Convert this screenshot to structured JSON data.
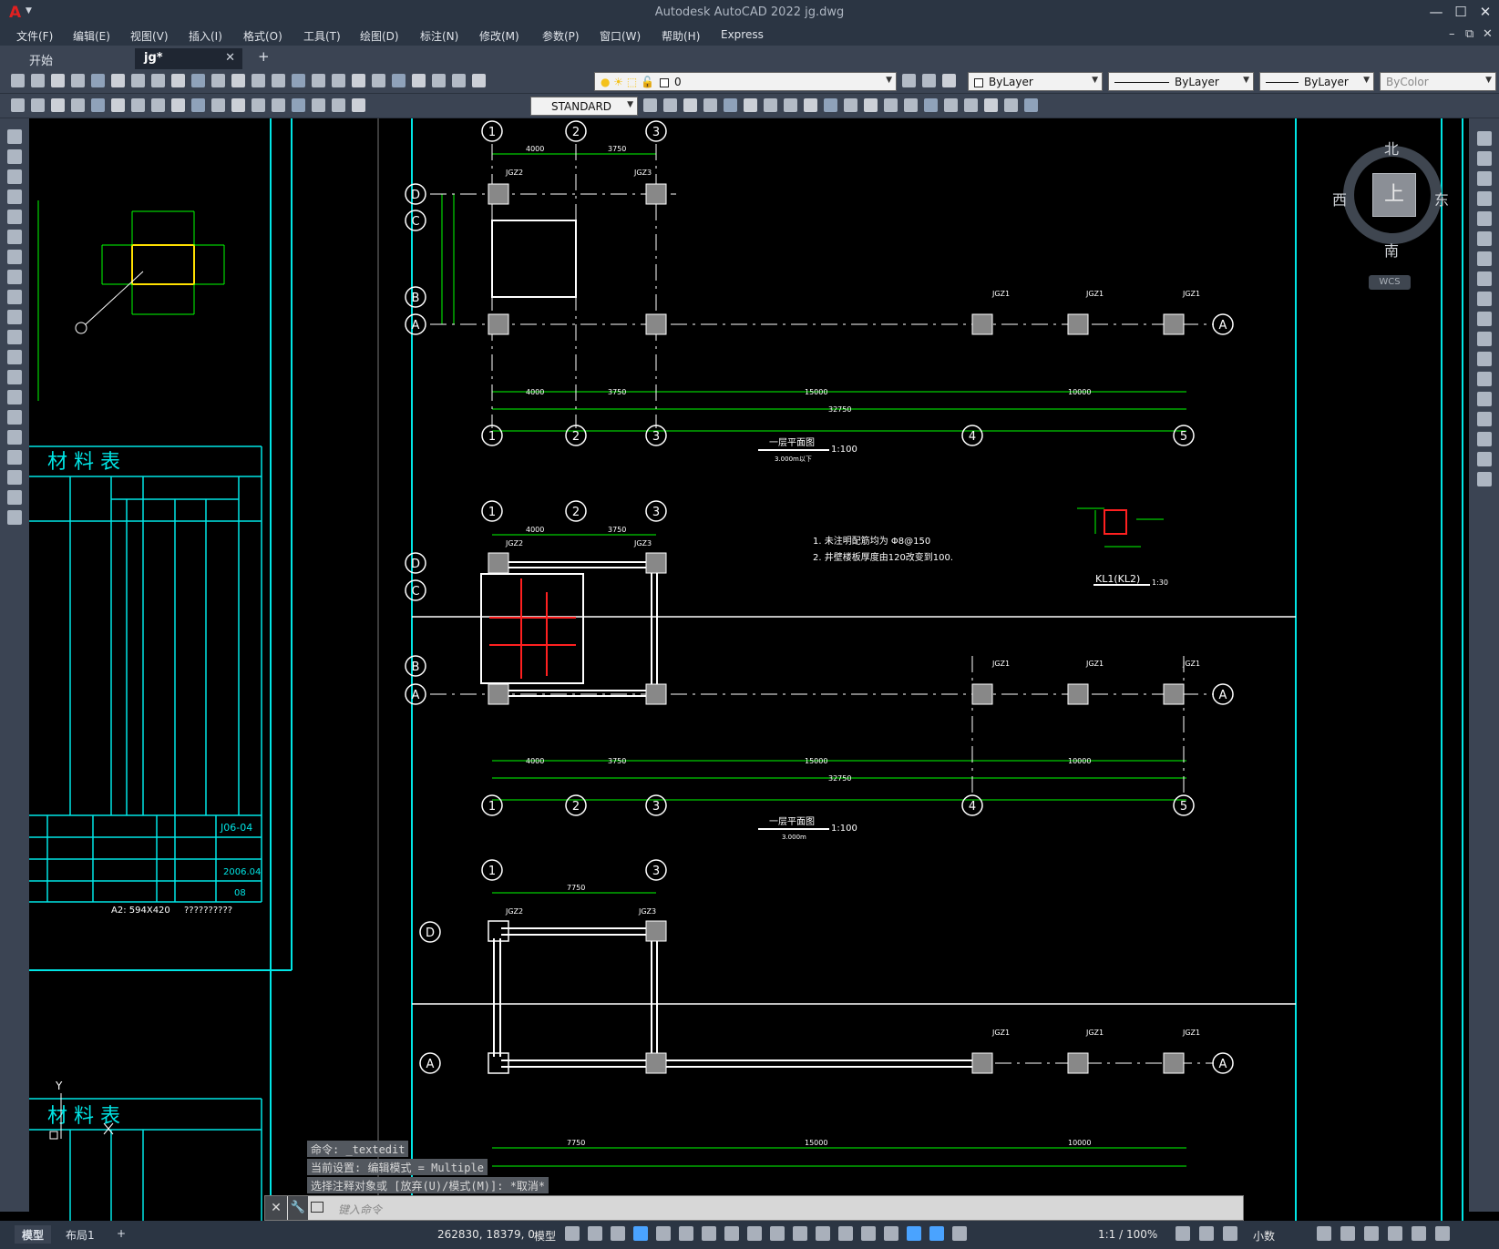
{
  "window": {
    "title": "Autodesk AutoCAD 2022    jg.dwg",
    "logo": "A",
    "minimize": "—",
    "maximize": "☐",
    "close": "✕"
  },
  "menu": {
    "items": [
      "文件(F)",
      "编辑(E)",
      "视图(V)",
      "插入(I)",
      "格式(O)",
      "工具(T)",
      "绘图(D)",
      "标注(N)",
      "修改(M)",
      "参数(P)",
      "窗口(W)",
      "帮助(H)",
      "Express"
    ]
  },
  "tabs": {
    "start": "开始",
    "current": "jg*",
    "close": "✕",
    "add": "+"
  },
  "toolbar": {
    "layer": "0",
    "textstyle": "STANDARD",
    "color": "ByLayer",
    "linetype": "ByLayer",
    "lineweight": "ByLayer",
    "plotstyle": "ByColor"
  },
  "viewcube": {
    "north": "北",
    "south": "南",
    "east": "东",
    "west": "西",
    "top": "上",
    "wcs": "WCS"
  },
  "drawing": {
    "plan1_title": "一层平面图",
    "plan1_scale": "1:100",
    "plan1_sub": "3.000m以下",
    "plan2_title": "一层平面图",
    "plan2_scale": "1:100",
    "plan2_sub": "3.000m",
    "note1": "1. 未注明配筋均为 Φ8@150",
    "note2": "2. 井壁楼板厚度由120改变到100.",
    "kl_title": "KL1(KL2)",
    "kl_scale": "1:30",
    "material_title": "材 料 表",
    "material_title2": "材 料 表",
    "sheet_no": "J06-04",
    "sheet_date": "2006.04",
    "sheet_num": "08",
    "paper_size": "A2: 594X420",
    "paper_code": "??????????",
    "col_jgz1": "JGZ1",
    "col_jgz2": "JGZ2",
    "col_jgz3": "JGZ3",
    "dim_4000": "4000",
    "dim_3750": "3750",
    "dim_15000": "15000",
    "dim_10000": "10000",
    "dim_32750": "32750",
    "dim_7750": "7750"
  },
  "command": {
    "history": [
      "命令: _textedit",
      "当前设置: 编辑模式 = Multiple",
      "选择注释对象或 [放弃(U)/模式(M)]: *取消*"
    ],
    "placeholder": "键入命令"
  },
  "status": {
    "model_tab": "模型",
    "layout1_tab": "布局1",
    "add_tab": "+",
    "coords": "262830, 18379, 0",
    "space": "模型",
    "scale": "1:1 / 100%",
    "units": "小数"
  }
}
